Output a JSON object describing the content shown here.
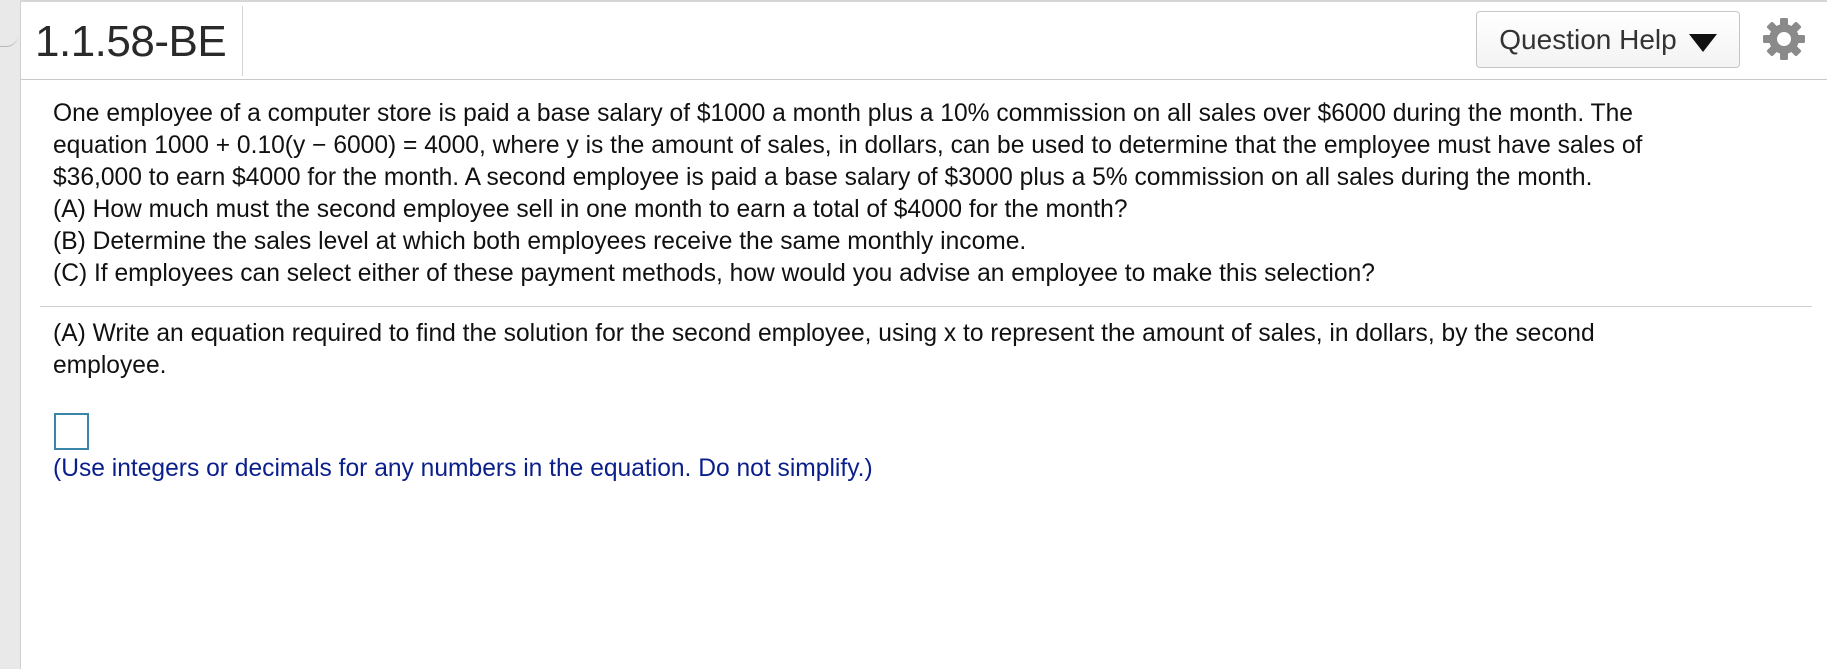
{
  "header": {
    "question_id": "1.1.58-BE",
    "help_label": "Question Help"
  },
  "icons": {
    "help_caret": "caret-down-icon",
    "settings": "gear-icon"
  },
  "problem": {
    "line1": "One employee of a computer store is paid a base salary of $1000 a month plus a 10% commission on all sales over $6000 during the month. The",
    "line2": "equation 1000 + 0.10(y − 6000) = 4000, where y is the amount of sales, in dollars, can be used to determine that the employee must have sales of",
    "line3": "$36,000 to earn $4000 for the month. A second employee is paid a base salary of $3000 plus a 5% commission on all sales during the month.",
    "partA": "(A) How much must the second employee sell in one month to earn a total of $4000 for the month?",
    "partB": "(B) Determine the sales level at which both employees receive the same monthly income.",
    "partC": "(C) If employees can select either of these payment methods, how would you advise an employee to make this selection?"
  },
  "question": {
    "line1": "(A) Write an equation required to find the solution for the second employee, using x to represent the amount of sales, in dollars, by the second",
    "line2": "employee.",
    "answer_value": "",
    "hint": "(Use integers or decimals for any numbers in the equation. Do not simplify.)"
  },
  "colors": {
    "hint_text": "#0b1f8c",
    "answer_box_border": "#3a86a8"
  }
}
